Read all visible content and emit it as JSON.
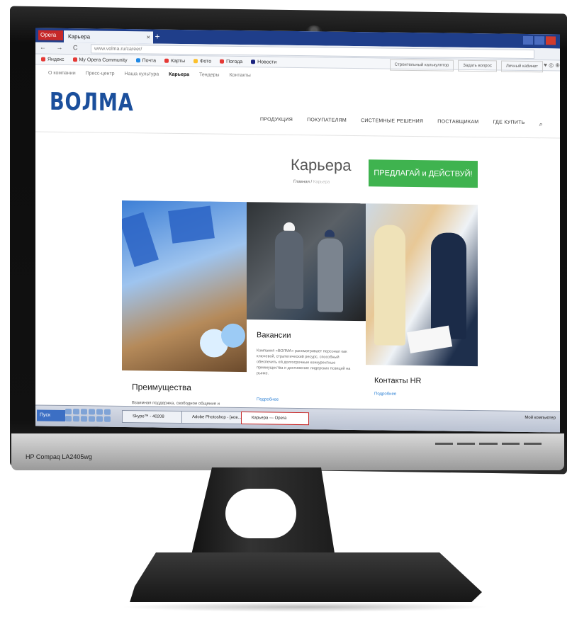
{
  "monitor": {
    "model": "HP Compaq LA2405wg"
  },
  "browser": {
    "menu_label": "Opera",
    "tab_title": "Карьера",
    "tab_close": "×",
    "new_tab": "+",
    "nav_symbols": "← → C",
    "url": "www.volma.ru/career/",
    "bookmarks": [
      "Яндекс",
      "My Opera Community",
      "Почта",
      "Карты",
      "Фото",
      "Погода",
      "Новости"
    ],
    "bookmark_colors": [
      "#e53935",
      "#e53935",
      "#1e88e5",
      "#e53935",
      "#fbc02d",
      "#e53935",
      "#1a237e"
    ],
    "toolbar_icons": "♥ ◎ ⊕"
  },
  "site": {
    "top_menu": [
      "О компании",
      "Пресс-центр",
      "Наша культура",
      "Карьера",
      "Тендеры",
      "Контакты"
    ],
    "top_menu_active": "Карьера",
    "top_buttons": [
      "Строительный калькулятор",
      "Задать вопрос",
      "Личный кабинет"
    ],
    "logo": "ВОЛМА",
    "main_nav": [
      "ПРОДУКЦИЯ",
      "ПОКУПАТЕЛЯМ",
      "СИСТЕМНЫЕ РЕШЕНИЯ",
      "ПОСТАВЩИКАМ",
      "ГДЕ КУПИТЬ"
    ],
    "search_icon": "⌕",
    "page_title": "Карьера",
    "breadcrumb_home": "Главная /",
    "breadcrumb_current": "Карьера",
    "cta_button": "ПРЕДЛАГАЙ и ДЕЙСТВУЙ!",
    "cards": [
      {
        "title": "Преимущества",
        "text": "Взаимная поддержка, свободное общение и возможность участвовать в развитии…"
      },
      {
        "title": "Вакансии",
        "text": "Компания «ВОЛМА» рассматривает персонал как ключевой, стратегический ресурс, способный обеспечить ей долгосрочные конкурентные преимущества и достижение лидерских позиций на рынке.",
        "more": "Подробнее"
      },
      {
        "title": "Контакты HR",
        "more": "Подробнее"
      }
    ]
  },
  "taskbar": {
    "start": "Пуск",
    "tasks": [
      "Skype™ - 40208",
      "Adobe Photoshop - [нов...",
      "Карьера — Opera"
    ],
    "active_task": "Карьера — Opera",
    "tray": "Мой компьютер"
  },
  "colors": {
    "brand": "#1b4f9c",
    "cta": "#3fb34f",
    "browser_chrome": "#1f3e8a"
  }
}
